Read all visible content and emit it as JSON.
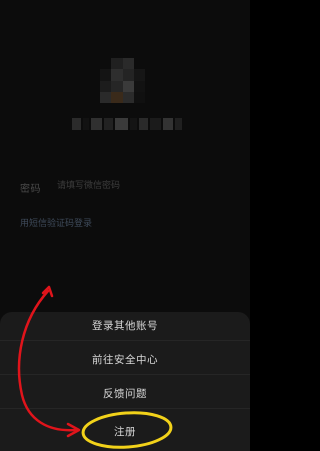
{
  "login": {
    "password_label": "密码",
    "password_placeholder": "请填写微信密码",
    "sms_login_link": "用短信验证码登录"
  },
  "action_sheet": {
    "items": [
      {
        "label": "登录其他账号"
      },
      {
        "label": "前往安全中心"
      },
      {
        "label": "反馈问题"
      },
      {
        "label": "注册"
      }
    ]
  },
  "colors": {
    "background": "#0c0c0c",
    "sheet": "#1b1b1b",
    "annotation_arrow": "#e0141b",
    "annotation_circle": "#f2d21a"
  }
}
